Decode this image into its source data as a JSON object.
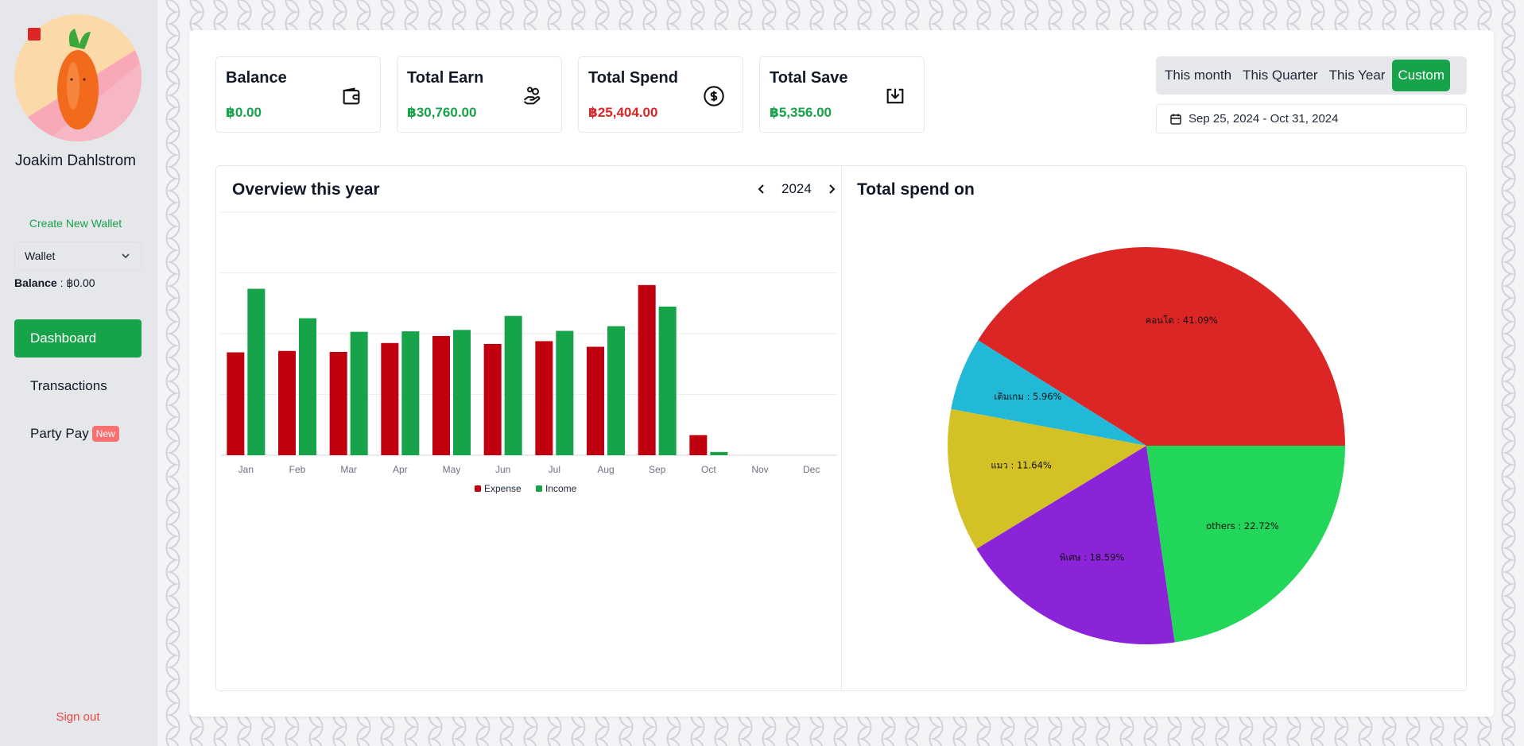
{
  "sidebar": {
    "user_name": "Joakim Dahlstrom",
    "create_wallet": "Create New Wallet",
    "wallet_select": "Wallet",
    "balance_label": "Balance",
    "balance_value": " : ฿0.00",
    "nav": [
      {
        "label": "Dashboard"
      },
      {
        "label": "Transactions"
      },
      {
        "label": "Party Pay",
        "badge": "New"
      }
    ],
    "sign_out": "Sign out"
  },
  "stats": [
    {
      "title": "Balance",
      "value": "฿0.00",
      "icon": "wallet-icon"
    },
    {
      "title": "Total Earn",
      "value": "฿30,760.00",
      "icon": "hand-coins-icon"
    },
    {
      "title": "Total Spend",
      "value": "฿25,404.00",
      "icon": "dollar-circle-icon"
    },
    {
      "title": "Total Save",
      "value": "฿5,356.00",
      "icon": "download-icon"
    }
  ],
  "periods": [
    "This month",
    "This Quarter",
    "This Year",
    "Custom"
  ],
  "active_period": "Custom",
  "date_range": "Sep 25, 2024 - Oct 31, 2024",
  "overview": {
    "title": "Overview this year",
    "year": "2024"
  },
  "spend": {
    "title": "Total spend on"
  },
  "colors": {
    "accent": "#16a34a",
    "expense": "#c0000f",
    "income": "#16a34a"
  },
  "chart_data": [
    {
      "type": "bar",
      "categories": [
        "Jan",
        "Feb",
        "Mar",
        "Apr",
        "May",
        "Jun",
        "Jul",
        "Aug",
        "Sep",
        "Oct",
        "Nov",
        "Dec"
      ],
      "series": [
        {
          "name": "Expense",
          "values": [
            2200,
            2230,
            2210,
            2400,
            2550,
            2380,
            2440,
            2320,
            3640,
            430,
            0,
            0
          ]
        },
        {
          "name": "Income",
          "values": [
            3560,
            2930,
            2640,
            2650,
            2680,
            2980,
            2660,
            2760,
            3180,
            70,
            0,
            0
          ]
        }
      ],
      "ylim": [
        0,
        5200
      ],
      "grid": true,
      "legend": "bottom"
    },
    {
      "type": "pie",
      "slices": [
        {
          "label": "คอนโด",
          "value": 41.09,
          "color": "#dc2626"
        },
        {
          "label": "เติมเกม",
          "value": 5.96,
          "color": "#22b8d8"
        },
        {
          "label": "แมว",
          "value": 11.64,
          "color": "#d4c125"
        },
        {
          "label": "พิเศษ",
          "value": 18.59,
          "color": "#8b24d9"
        },
        {
          "label": "others",
          "value": 22.72,
          "color": "#22d65a"
        }
      ]
    }
  ]
}
